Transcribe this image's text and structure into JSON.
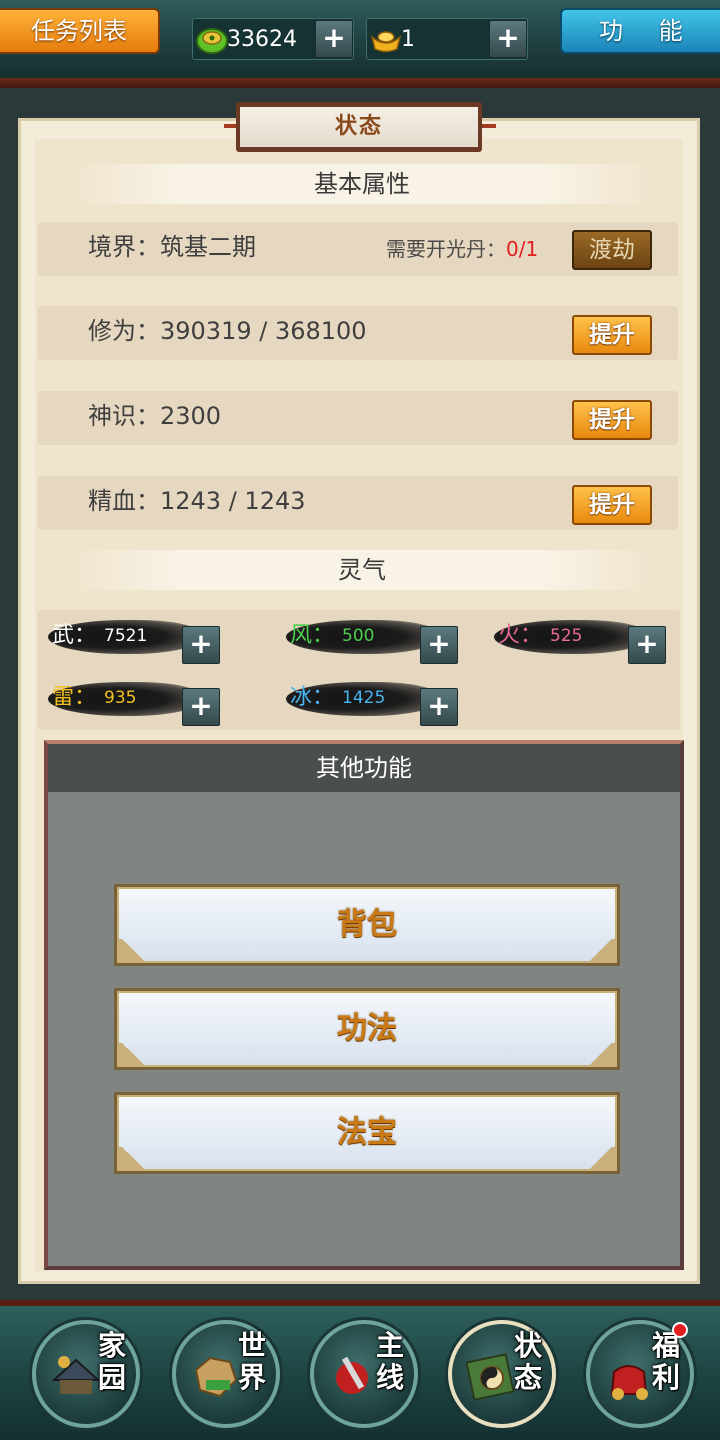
{
  "topbar": {
    "task_button": "任务列表",
    "function_button": "功 能",
    "jade_value": "33624",
    "gold_value": "1",
    "plus": "+"
  },
  "panel": {
    "title": "状态",
    "basic_header": "基本属性",
    "realm": {
      "label": "境界：筑基二期",
      "requirement_label": "需要开光丹：",
      "requirement_value": "0/1",
      "button": "渡劫"
    },
    "cultivation": {
      "label": "修为：390319 / 368100",
      "button": "提升"
    },
    "spirit": {
      "label": "神识：2300",
      "button": "提升"
    },
    "blood": {
      "label": "精血：1243 / 1243",
      "button": "提升"
    },
    "lingqi_header": "灵气",
    "elements": [
      {
        "name": "武：",
        "value": "7521",
        "color": "#ffffff"
      },
      {
        "name": "风：",
        "value": "500",
        "color": "#4ccf4c"
      },
      {
        "name": "火：",
        "value": "525",
        "color": "#e86a9a"
      },
      {
        "name": "雷：",
        "value": "935",
        "color": "#f0c020"
      },
      {
        "name": "冰：",
        "value": "1425",
        "color": "#48b4f0"
      }
    ]
  },
  "other": {
    "header": "其他功能",
    "buttons": [
      "背包",
      "功法",
      "法宝"
    ]
  },
  "nav": [
    {
      "label_top": "家",
      "label_bottom": "园",
      "icon": "home-icon"
    },
    {
      "label_top": "世",
      "label_bottom": "界",
      "icon": "world-icon"
    },
    {
      "label_top": "主",
      "label_bottom": "线",
      "icon": "mainline-icon"
    },
    {
      "label_top": "状",
      "label_bottom": "态",
      "icon": "status-icon"
    },
    {
      "label_top": "福",
      "label_bottom": "利",
      "icon": "welfare-icon"
    }
  ],
  "colors": {
    "gold_button": "#f0a020",
    "requirement_red": "#e21e1e",
    "title_brown": "#8a4a1c"
  }
}
